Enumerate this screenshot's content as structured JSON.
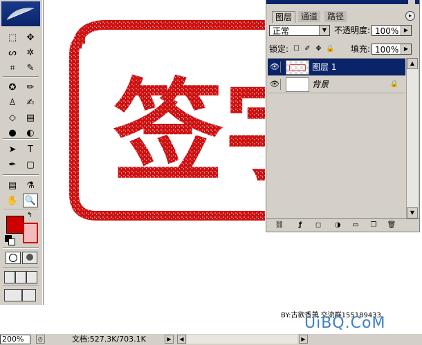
{
  "tools": [
    {
      "name": "marquee-tool",
      "glyph": "⬚"
    },
    {
      "name": "move-tool",
      "glyph": "✥"
    },
    {
      "name": "lasso-tool",
      "glyph": "ᔕ"
    },
    {
      "name": "magic-wand-tool",
      "glyph": "✲"
    },
    {
      "name": "crop-tool",
      "glyph": "⌗"
    },
    {
      "name": "slice-tool",
      "glyph": "✎"
    },
    {
      "name": "healing-brush-tool",
      "glyph": "✪"
    },
    {
      "name": "brush-tool",
      "glyph": "✏"
    },
    {
      "name": "stamp-tool",
      "glyph": "♙"
    },
    {
      "name": "history-brush-tool",
      "glyph": "✍"
    },
    {
      "name": "eraser-tool",
      "glyph": "◇"
    },
    {
      "name": "gradient-tool",
      "glyph": "▤"
    },
    {
      "name": "blur-tool",
      "glyph": "●"
    },
    {
      "name": "dodge-tool",
      "glyph": "◐"
    },
    {
      "name": "path-selection-tool",
      "glyph": "➤"
    },
    {
      "name": "type-tool",
      "glyph": "T"
    },
    {
      "name": "pen-tool",
      "glyph": "✒"
    },
    {
      "name": "shape-tool",
      "glyph": "▢"
    },
    {
      "name": "notes-tool",
      "glyph": "▤"
    },
    {
      "name": "eyedropper-tool",
      "glyph": "⚗"
    },
    {
      "name": "hand-tool",
      "glyph": "✋"
    },
    {
      "name": "zoom-tool",
      "glyph": "🔍"
    }
  ],
  "canvas": {
    "stamp_text": "签字",
    "stamp_color": "#cc1111"
  },
  "credit": "BY:古欲香萧  交流群155189433",
  "watermark": "UiBQ.CoM",
  "panel": {
    "tabs": [
      "图层",
      "通道",
      "路径"
    ],
    "menu_glyph": "▸",
    "blend_mode": "正常",
    "opacity_label": "不透明度:",
    "opacity_value": "100%",
    "lock_label": "锁定:",
    "lock_icons": [
      "☐",
      "✐",
      "✥",
      "🔒"
    ],
    "fill_label": "填充:",
    "fill_value": "100%",
    "layers": [
      {
        "name": "图层 1",
        "selected": true,
        "visible_glyph": "👁"
      },
      {
        "name": "背景",
        "selected": false,
        "visible_glyph": "👁",
        "locked_glyph": "🔒"
      }
    ],
    "bottom_icons": [
      "⛓",
      "ƒ",
      "◻",
      "◑",
      "▭",
      "❐",
      "🗑"
    ]
  },
  "status": {
    "zoom": "200%",
    "doc_info": "文档:527.3K/703.1K"
  },
  "colors": {
    "foreground": "#cc0000",
    "background": "#f2bcbc",
    "selection": "#0a246a"
  }
}
